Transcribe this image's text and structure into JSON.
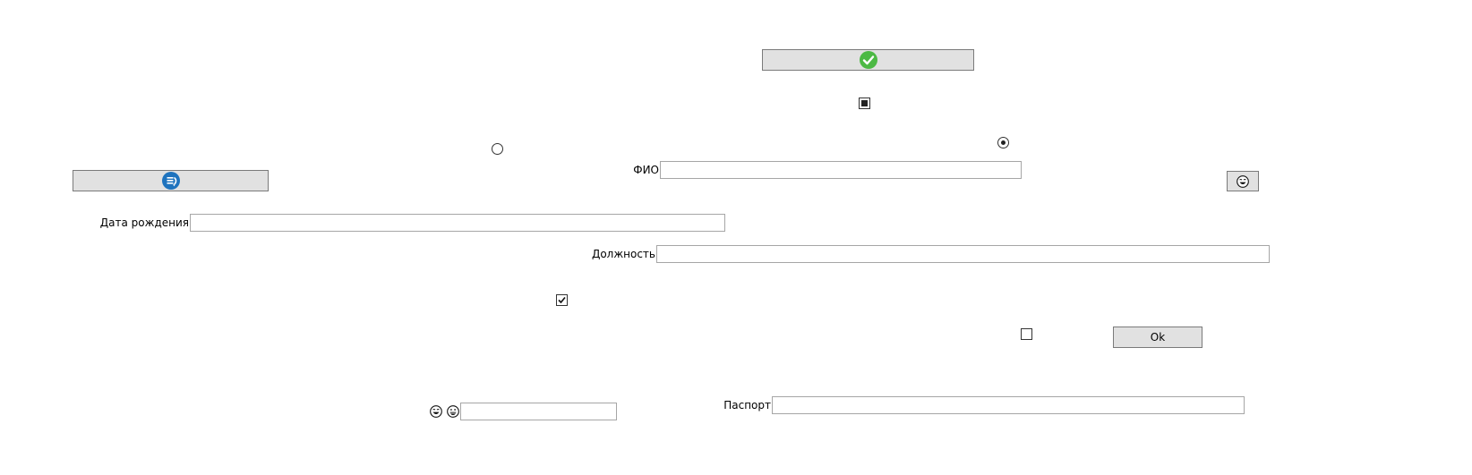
{
  "form": {
    "ok_button_label": "Ok",
    "fio_label": "ФИО",
    "fio_value": "",
    "birthdate_label": "Дата рождения",
    "birthdate_value": "",
    "position_label": "Должность",
    "position_value": "",
    "passport_label": "Паспорт",
    "passport_value": "",
    "bottom_field_value": ""
  },
  "controls": {
    "confirm_button_icon": "green-check-icon",
    "reload_button_icon": "blue-reload-icon",
    "emoji_button_icon": "laughing-face-icon",
    "checkbox_indeterminate_state": "indeterminate",
    "checkbox_checked_state": "checked",
    "checkbox_unchecked_state": "unchecked",
    "radio_left_selected": false,
    "radio_right_selected": true
  },
  "colors": {
    "button_bg": "#e1e1e1",
    "button_border": "#7a7a7a",
    "check_green": "#4cb944",
    "reload_blue": "#1e73be"
  }
}
